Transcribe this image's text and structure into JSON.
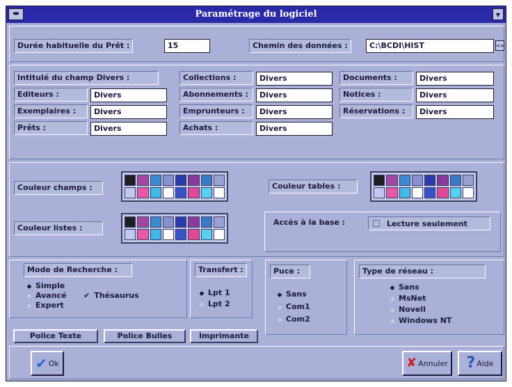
{
  "window": {
    "title": "Paramétrage du logiciel"
  },
  "top": {
    "duree_label": "Durée habituelle du Prêt :",
    "duree_value": "15",
    "chemin_label": "Chemin des données :",
    "chemin_value": "C:\\BCDI\\HIST"
  },
  "fields": {
    "intitule_label": "Intitulé du champ Divers :",
    "col1": [
      {
        "label": "Editeurs :",
        "value": "Divers"
      },
      {
        "label": "Exemplaires :",
        "value": "Divers"
      },
      {
        "label": "Prêts :",
        "value": "Divers"
      }
    ],
    "col2": [
      {
        "label": "Collections :",
        "value": "Divers"
      },
      {
        "label": "Abonnements :",
        "value": "Divers"
      },
      {
        "label": "Emprunteurs :",
        "value": "Divers"
      },
      {
        "label": "Achats :",
        "value": "Divers"
      }
    ],
    "col3": [
      {
        "label": "Documents :",
        "value": "Divers"
      },
      {
        "label": "Notices :",
        "value": "Divers"
      },
      {
        "label": "Réservations :",
        "value": "Divers"
      }
    ]
  },
  "colors": {
    "couleur_champs_label": "Couleur champs :",
    "couleur_tables_label": "Couleur tables :",
    "couleur_listes_label": "Couleur listes :",
    "acces_label": "Accès à la base :",
    "acces_value": "Lecture seulement",
    "palette": [
      "#1e1e1e",
      "#a048a0",
      "#3a8ad0",
      "#8890d0",
      "#2a3aa8",
      "#8a3a9a",
      "#3a78c8",
      "#9aa2d4",
      "#c4c8f0",
      "#e858a8",
      "#40b8e8",
      "#ffffff",
      "#3a52c8",
      "#e04898",
      "#58d0f0",
      "#ffffff"
    ]
  },
  "mode_recherche": {
    "title": "Mode de Recherche :",
    "options": [
      {
        "label": "Simple",
        "selected": true
      },
      {
        "label": "Avancé",
        "selected": false
      },
      {
        "label": "Expert",
        "selected": false
      }
    ],
    "thesaurus_label": "Thésaurus",
    "thesaurus_check": "✔"
  },
  "transfert": {
    "title": "Transfert :",
    "options": [
      {
        "label": "Lpt 1",
        "selected": true
      },
      {
        "label": "Lpt 2",
        "selected": false
      }
    ]
  },
  "puce": {
    "title": "Puce :",
    "options": [
      {
        "label": "Sans",
        "selected": true
      },
      {
        "label": "Com1",
        "selected": false
      },
      {
        "label": "Com2",
        "selected": false
      }
    ]
  },
  "reseau": {
    "title": "Type de réseau :",
    "options": [
      {
        "label": "Sans",
        "selected": true
      },
      {
        "label": "MsNet",
        "selected": false
      },
      {
        "label": "Novell",
        "selected": false
      },
      {
        "label": "Windows NT",
        "selected": false
      }
    ]
  },
  "buttons": {
    "police_texte": "Police Texte",
    "police_bulles": "Police Bulles",
    "imprimante": "Imprimante",
    "ok": "Ok",
    "annuler": "Annuler",
    "aide": "Aide"
  }
}
